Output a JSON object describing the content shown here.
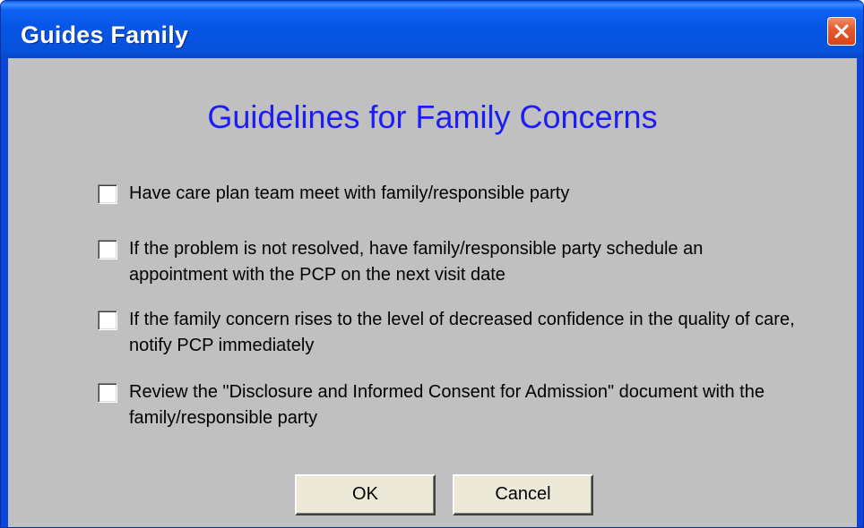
{
  "window": {
    "title": "Guides Family",
    "close_icon": "close-icon"
  },
  "dialog": {
    "heading": "Guidelines for Family Concerns",
    "items": [
      {
        "label": "Have care plan team meet with family/responsible party",
        "checked": false
      },
      {
        "label": "If the problem is not resolved, have family/responsible party schedule an appointment with the PCP on the next visit date",
        "checked": false
      },
      {
        "label": "If the family concern rises to the level of decreased confidence in the quality of care, notify PCP immediately",
        "checked": false
      },
      {
        "label": "Review the \"Disclosure and Informed Consent for Admission\" document with the family/responsible party",
        "checked": false
      }
    ],
    "ok_label": "OK",
    "cancel_label": "Cancel"
  },
  "colors": {
    "titlebar": "#0756e6",
    "client_bg": "#c0c0c0",
    "heading": "#1c1cf6",
    "close_button": "#e35b2f"
  }
}
